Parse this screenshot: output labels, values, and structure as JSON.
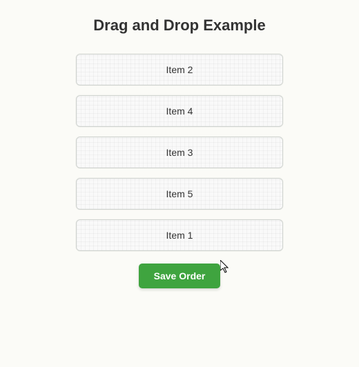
{
  "title": "Drag and Drop Example",
  "items": [
    {
      "label": "Item 2"
    },
    {
      "label": "Item 4"
    },
    {
      "label": "Item 3"
    },
    {
      "label": "Item 5"
    },
    {
      "label": "Item 1"
    }
  ],
  "actions": {
    "save_label": "Save Order"
  }
}
